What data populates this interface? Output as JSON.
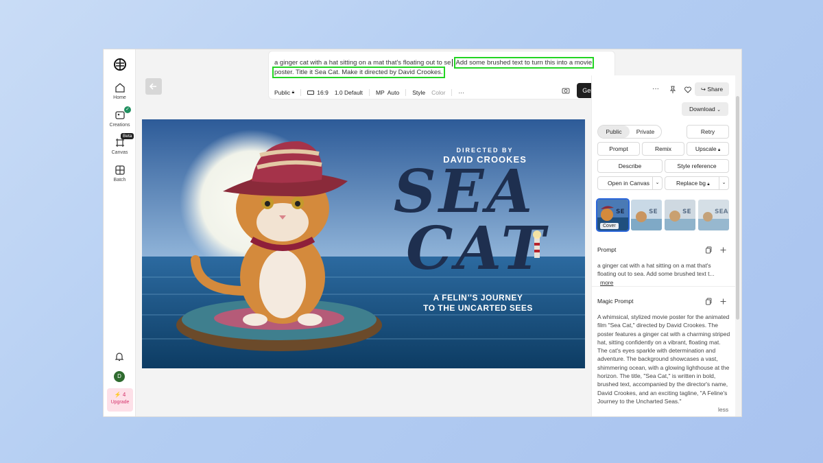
{
  "sidebar": {
    "items": [
      {
        "label": "Home"
      },
      {
        "label": "Creations"
      },
      {
        "label": "Canvas",
        "badge": "Beta"
      },
      {
        "label": "Batch"
      }
    ],
    "avatar_initial": "D",
    "upgrade": {
      "count": "4",
      "label": "Upgrade"
    }
  },
  "prompt": {
    "text_before": "a ginger cat with a hat sitting on a mat that's floating out to se",
    "text_highlight_1": "Add some brushed text to turn this into a movie",
    "text_highlight_2": "poster. Title it Sea Cat. Make it directed by David Crookes.",
    "toolbar": {
      "visibility": "Public",
      "aspect": "16:9",
      "model": "1.0 Default",
      "mp_label": "MP",
      "mp_value": "Auto",
      "style": "Style",
      "color": "Color",
      "more": "···"
    },
    "generate": "Generate"
  },
  "poster": {
    "directed_by": "DIRECTED BY",
    "director": "DAVID CROOKES",
    "title_line1": "SEA",
    "title_line2": "CAT",
    "tagline_1": "A FELIN’’S JOURNEY",
    "tagline_2": "TO THE UNCARTED SEES"
  },
  "panel": {
    "share": "Share",
    "download": "Download",
    "visibility": {
      "public": "Public",
      "private": "Private"
    },
    "buttons": {
      "retry": "Retry",
      "prompt": "Prompt",
      "remix": "Remix",
      "upscale": "Upscale",
      "describe": "Describe",
      "style_reference": "Style reference",
      "open_in_canvas": "Open in Canvas",
      "replace_bg": "Replace bg"
    },
    "cover": "Cover",
    "prompt_section": {
      "title": "Prompt",
      "text": "a ginger cat with a hat sitting on a mat that's floating out to sea. Add some brushed text t...",
      "more": "more"
    },
    "magic_prompt": {
      "title": "Magic Prompt",
      "text": "A whimsical, stylized movie poster for the animated film \"Sea Cat,\" directed by David Crookes. The poster features a ginger cat with a charming striped hat, sitting confidently on a vibrant, floating mat. The cat's eyes sparkle with determination and adventure. The background showcases a vast, shimmering ocean, with a glowing lighthouse at the horizon. The title, \"Sea Cat,\" is written in bold, brushed text, accompanied by the director's name, David Crookes, and an exciting tagline, \"A Feline's Journey to the Uncharted Seas.\"",
      "less": "less"
    }
  },
  "colors": {
    "highlight": "#22d422",
    "generate_bg": "#1f1f1f",
    "accent_blue": "#2b66d9"
  }
}
